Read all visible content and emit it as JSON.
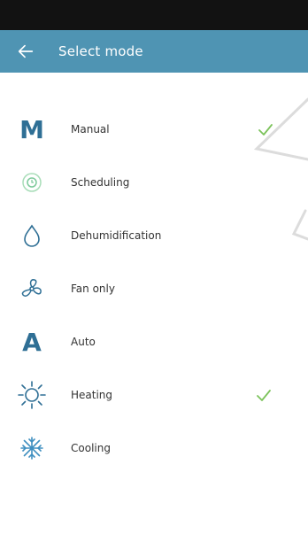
{
  "appbar": {
    "title": "Select mode",
    "back_icon": "arrow-left-icon"
  },
  "colors": {
    "appbar_bg": "#4f94b3",
    "icon": "#2f6f95",
    "check": "#7cc35b",
    "status_bar": "#121212"
  },
  "modes": [
    {
      "label": "Manual",
      "icon": "letter-m-icon",
      "checked": true
    },
    {
      "label": "Scheduling",
      "icon": "schedule-icon",
      "checked": false
    },
    {
      "label": "Dehumidification",
      "icon": "water-drop-icon",
      "checked": false
    },
    {
      "label": "Fan only",
      "icon": "fan-icon",
      "checked": false
    },
    {
      "label": "Auto",
      "icon": "letter-a-icon",
      "checked": false
    },
    {
      "label": "Heating",
      "icon": "sun-icon",
      "checked": true
    },
    {
      "label": "Cooling",
      "icon": "snowflake-icon",
      "checked": false
    }
  ]
}
